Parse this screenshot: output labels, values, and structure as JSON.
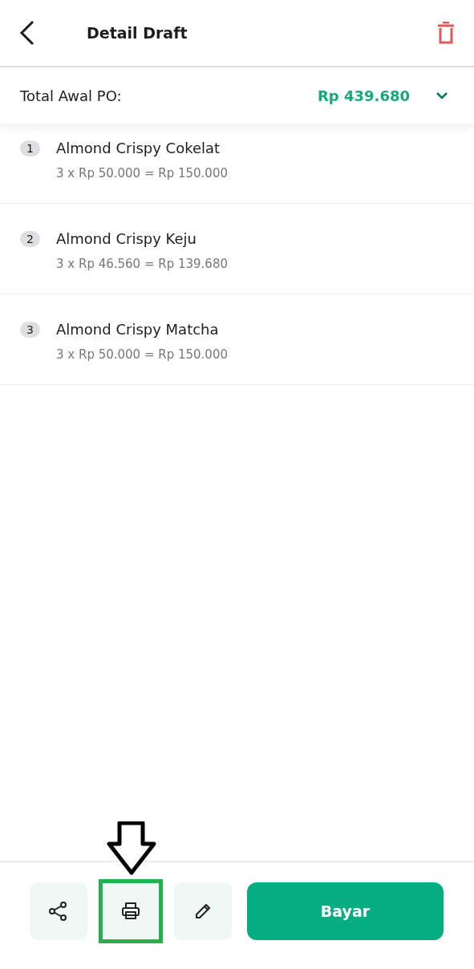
{
  "header": {
    "title": "Detail Draft"
  },
  "summary": {
    "label": "Total Awal PO:",
    "amount": "Rp 439.680",
    "expanded": false
  },
  "items": [
    {
      "number": "1",
      "name": "Almond Crispy Cokelat",
      "detail": "3 x Rp 50.000 = Rp 150.000"
    },
    {
      "number": "2",
      "name": "Almond Crispy Keju",
      "detail": "3 x Rp 46.560 = Rp 139.680"
    },
    {
      "number": "3",
      "name": "Almond Crispy Matcha",
      "detail": "3 x Rp 50.000 = Rp 150.000"
    }
  ],
  "actions": [
    {
      "kind": "share",
      "highlighted": false
    },
    {
      "kind": "print",
      "highlighted": true
    },
    {
      "kind": "edit",
      "highlighted": false
    },
    {
      "kind": "primary",
      "label": "Bayar",
      "highlighted": false
    }
  ]
}
